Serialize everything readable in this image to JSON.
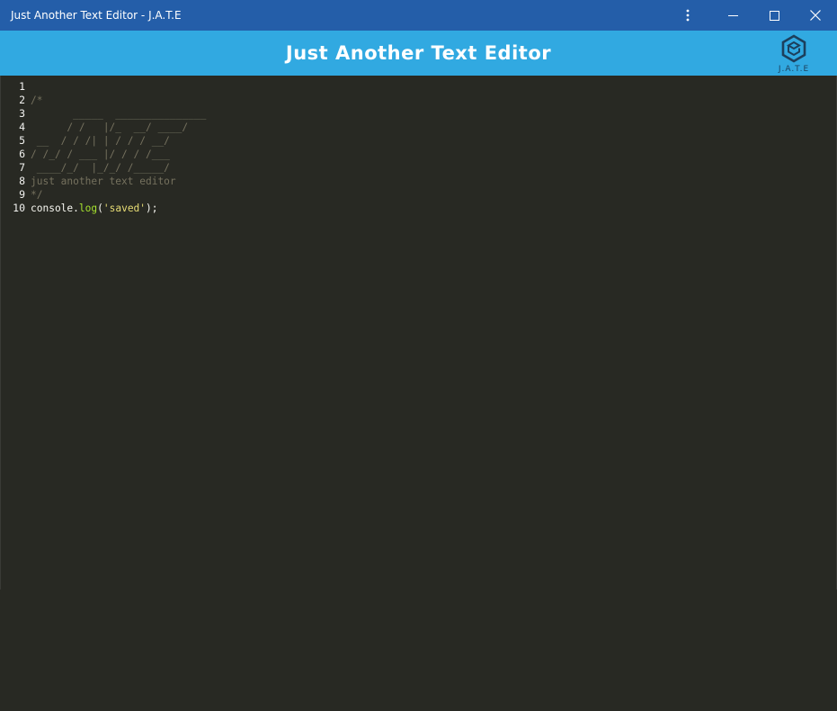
{
  "window": {
    "title": "Just Another Text Editor - J.A.T.E",
    "controls": {
      "menu_icon": "more-vertical-icon",
      "minimize_icon": "minimize-icon",
      "maximize_icon": "maximize-icon",
      "close_icon": "close-icon"
    }
  },
  "header": {
    "title": "Just Another Text Editor",
    "logo_text": "J.A.T.E",
    "logo_icon": "cube-logo-icon",
    "background": "#31a9e1"
  },
  "titlebar_color": "#245ea9",
  "editor": {
    "background": "#282923",
    "line_numbers": [
      "1",
      "2",
      "3",
      "4",
      "5",
      "6",
      "7",
      "8",
      "9",
      "10"
    ],
    "comment_lines": [
      "",
      "/*",
      "       _____  _______________",
      "      / /   |/_  __/ ____/",
      " __  / / /| | / / / __/",
      "/ /_/ / ___ |/ / / /___",
      " ____/_/  |_/_/ /_____/",
      "just another text editor",
      "*/"
    ],
    "code_line": {
      "object": "console",
      "dot": ".",
      "method": "log",
      "open": "(",
      "string": "'saved'",
      "close": ");"
    },
    "colors": {
      "comment": "#75715e",
      "text": "#f8f8f2",
      "function": "#a6e22e",
      "string": "#e6db74"
    }
  }
}
